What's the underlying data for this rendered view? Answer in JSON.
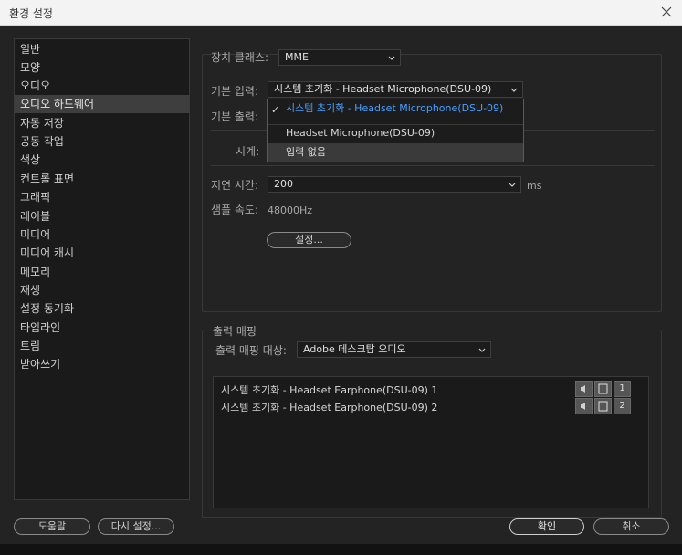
{
  "window": {
    "title": "환경 설정"
  },
  "sidebar": {
    "items": [
      {
        "label": "일반"
      },
      {
        "label": "모양"
      },
      {
        "label": "오디오"
      },
      {
        "label": "오디오 하드웨어",
        "selected": true
      },
      {
        "label": "자동 저장"
      },
      {
        "label": "공동 작업"
      },
      {
        "label": "색상"
      },
      {
        "label": "컨트롤 표면"
      },
      {
        "label": "그래픽"
      },
      {
        "label": "레이블"
      },
      {
        "label": "미디어"
      },
      {
        "label": "미디어 캐시"
      },
      {
        "label": "메모리"
      },
      {
        "label": "재생"
      },
      {
        "label": "설정 동기화"
      },
      {
        "label": "타임라인"
      },
      {
        "label": "트림"
      },
      {
        "label": "받아쓰기"
      }
    ]
  },
  "hardware": {
    "device_class_label": "장치 클래스:",
    "device_class_value": "MME",
    "default_input_label": "기본 입력:",
    "default_input_value": "시스템 초기화 - Headset Microphone(DSU-09)",
    "default_output_label": "기본 출력:",
    "master_clock_label": "시계:",
    "latency_label": "지연 시간:",
    "latency_value": "200",
    "latency_unit": "ms",
    "sample_rate_label": "샘플 속도:",
    "sample_rate_value": "48000Hz",
    "settings_button": "설정..."
  },
  "input_popup": {
    "options": [
      {
        "label": "시스템 초기화 - Headset Microphone(DSU-09)",
        "checked": true
      },
      {
        "label": "Headset Microphone(DSU-09)"
      },
      {
        "label": "입력 없음",
        "hover": true
      }
    ]
  },
  "output_mapping": {
    "group_label": "출력 매핑",
    "target_label": "출력 매핑 대상:",
    "target_value": "Adobe 데스크탑 오디오",
    "rows": [
      {
        "label": "시스템 초기화 - Headset Earphone(DSU-09) 1",
        "channel": "1"
      },
      {
        "label": "시스템 초기화 - Headset Earphone(DSU-09) 2",
        "channel": "2"
      }
    ]
  },
  "footer": {
    "help_button": "도움말",
    "reset_button": "다시 설정...",
    "ok_button": "확인",
    "cancel_button": "취소"
  },
  "colors": {
    "accent": "#4a9eff",
    "background": "#232323"
  }
}
